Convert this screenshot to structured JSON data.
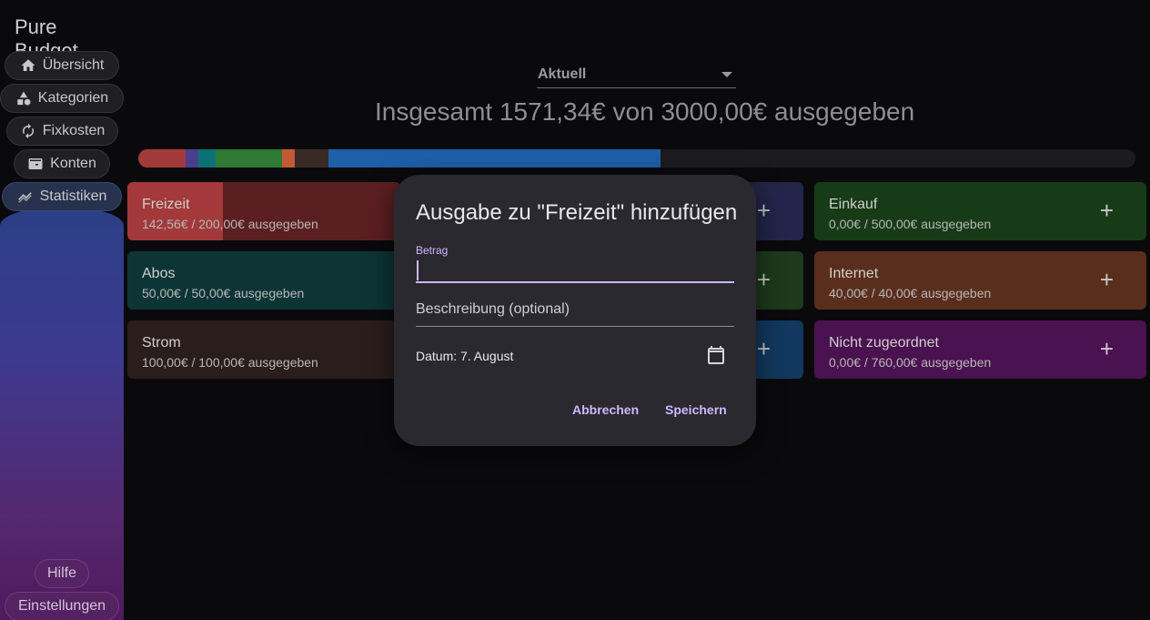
{
  "app": {
    "title": "Pure Budget"
  },
  "nav": {
    "items": [
      {
        "label": "Übersicht",
        "icon": "home-icon"
      },
      {
        "label": "Kategorien",
        "icon": "shapes-icon"
      },
      {
        "label": "Fixkosten",
        "icon": "refresh-icon"
      },
      {
        "label": "Konten",
        "icon": "wallet-icon"
      },
      {
        "label": "Statistiken",
        "icon": "chart-icon"
      }
    ],
    "active": "Statistiken",
    "help": "Hilfe",
    "settings": "Einstellungen"
  },
  "period": {
    "selected": "Aktuell"
  },
  "summary": {
    "total_text": "Insgesamt 1571,34€ von 3000,00€ ausgegeben",
    "spent_fraction": 0.5238
  },
  "categories": [
    {
      "name": "Freizeit",
      "amount": "142,56€ / 200,00€ ausgegeben",
      "spent_fraction": 0.713,
      "color": "#6b2222",
      "base": "#3a1a1c"
    },
    {
      "name": "Einkauf",
      "amount": "0,00€ / 500,00€ ausgegeben",
      "spent_fraction": 0,
      "color": "#1b3a1a",
      "base": "#153116"
    },
    {
      "name": "Abos",
      "amount": "50,00€ / 50,00€ ausgegeben",
      "spent_fraction": 1,
      "color": "#0e3536",
      "base": "#0e3536"
    },
    {
      "name": "Internet",
      "amount": "40,00€ / 40,00€ ausgegeben",
      "spent_fraction": 1,
      "color": "#5a2e1c",
      "base": "#5a2e1c"
    },
    {
      "name": "Strom",
      "amount": "100,00€ / 100,00€ ausgegeben",
      "spent_fraction": 1,
      "color": "#2a1e1c",
      "base": "#2a1e1c"
    },
    {
      "name": "Nicht zugeordnet",
      "amount": "0,00€ / 760,00€ ausgegeben",
      "spent_fraction": 0,
      "color": "#4a1250",
      "base": "#3e0f44"
    }
  ],
  "dialog": {
    "title": "Ausgabe zu \"Freizeit\" hinzufügen",
    "amount_label": "Betrag",
    "amount_value": "",
    "description_placeholder": "Beschreibung (optional)",
    "date_text": "Datum: 7. August",
    "cancel": "Abbrechen",
    "save": "Speichern"
  },
  "colors": {
    "accent": "#cdb8ff",
    "bar_segments": [
      "#a33a3a",
      "#4a3f8c",
      "#0e7077",
      "#2f7a35",
      "#c25a35",
      "#3a2a26",
      "#1e5fa8"
    ]
  }
}
